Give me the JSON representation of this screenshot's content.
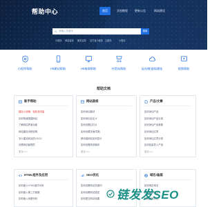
{
  "header": {
    "logo": "帮助中心",
    "nav": [
      "首页",
      "文档教程",
      "更新公告",
      "网站建设"
    ],
    "active_index": 0
  },
  "search": {
    "placeholder": "请输入关键字",
    "button": "搜索",
    "hot_links": [
      "小程序",
      "网站建设",
      "服务定制",
      "支付宝小程序",
      "云服务",
      "小程序"
    ]
  },
  "categories": [
    {
      "label": "小程序帮助",
      "icon": "mini-program-icon"
    },
    {
      "label": "H5建站帮助",
      "icon": "h5-site-icon"
    },
    {
      "label": "H5电商帮助",
      "icon": "h5-shop-icon"
    },
    {
      "label": "外贸站帮助",
      "icon": "trade-site-icon"
    },
    {
      "label": "云存储/虚拟建站",
      "icon": "cloud-icon"
    },
    {
      "label": "视频帮助",
      "icon": "video-icon"
    }
  ],
  "docs_title": "帮助文档",
  "cards": [
    {
      "title": "新手帮助",
      "items": [
        "建站小攻略，轻松涨流量",
        "如何快速搭建网站",
        "了解网站界面功能",
        "网站建设流程说明",
        "怎么建站网站的LOGO",
        "设置网站管理员",
        "更多>>>"
      ]
    },
    {
      "title": "网站装修",
      "items": [
        "如何添加模块",
        "如何添加自定义",
        "如何设置幻灯片",
        "如何设置页面/导航",
        "移动端网站如何显示",
        "如何设置底部模块",
        "更多>>>"
      ]
    },
    {
      "title": "产品/文章",
      "items": [
        "如何添加产品",
        "如何添加产品分类",
        "如何添加产品参数",
        "如何添加文章",
        "如何添加文章分类",
        "如何批量导入产品",
        "更多>>>"
      ]
    },
    {
      "title": "HTML组件及应用",
      "items": [
        "如何嵌入HTML组件代码",
        "如何嵌入第三方客服",
        "如何嵌入地图代码"
      ]
    },
    {
      "title": "SEO优化",
      "items": [
        "如何设置网站关键词",
        "如何设置网站描述",
        "如何提交网站地图"
      ]
    },
    {
      "title": "域名/备案",
      "items": [
        "如何绑定域名",
        "如何解析域名",
        "网站备案流程"
      ]
    }
  ],
  "watermark": "链发发SEO",
  "colors": {
    "accent": "#1f6fe0",
    "hero_bg": "#0f2444",
    "highlight": "#e03c3c",
    "watermark": "#1a8f86"
  }
}
